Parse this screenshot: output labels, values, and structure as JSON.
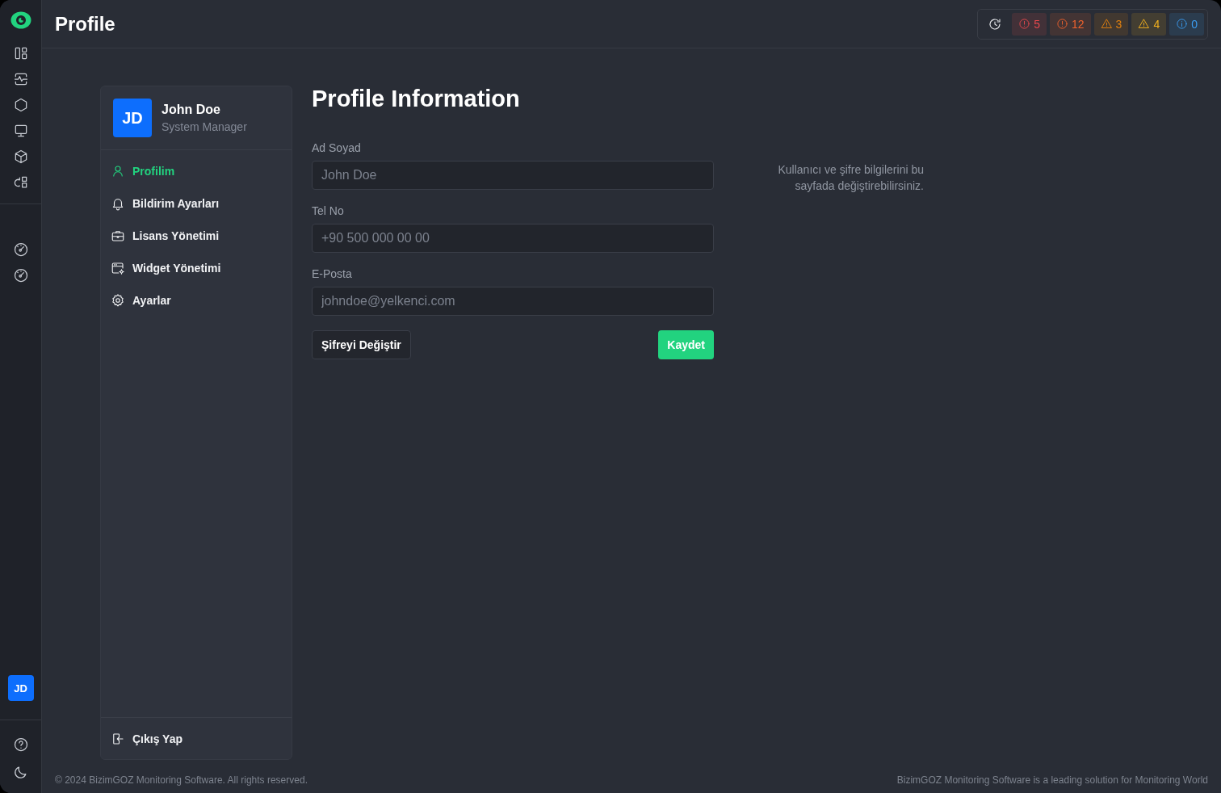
{
  "rail": {
    "top_icons": [
      {
        "kind": "layout"
      },
      {
        "kind": "pulse"
      },
      {
        "kind": "hexagon"
      },
      {
        "kind": "monitor"
      },
      {
        "kind": "cube"
      },
      {
        "kind": "refresh-grid"
      }
    ],
    "mid_icons": [
      {
        "kind": "gauge"
      },
      {
        "kind": "gauge"
      }
    ],
    "avatar": "JD",
    "bottom_icons": [
      {
        "kind": "help"
      },
      {
        "kind": "moon"
      }
    ]
  },
  "header": {
    "title": "Profile",
    "alerts": [
      {
        "kind": "error",
        "count": "5",
        "color": "#e5484d"
      },
      {
        "kind": "error",
        "count": "12",
        "color": "#f0622d"
      },
      {
        "kind": "warning",
        "count": "3",
        "color": "#e0800f"
      },
      {
        "kind": "warning",
        "count": "4",
        "color": "#f2b01e"
      },
      {
        "kind": "info",
        "count": "0",
        "color": "#3b9cf0"
      }
    ]
  },
  "profile_menu": {
    "avatar": "JD",
    "name": "John Doe",
    "role": "System Manager",
    "items": [
      {
        "kind": "user",
        "label": "Profilim",
        "selected": true
      },
      {
        "kind": "bell",
        "label": "Bildirim Ayarları",
        "selected": false
      },
      {
        "kind": "briefcase",
        "label": "Lisans Yönetimi",
        "selected": false
      },
      {
        "kind": "widget",
        "label": "Widget Yönetimi",
        "selected": false
      },
      {
        "kind": "gear",
        "label": "Ayarlar",
        "selected": false
      }
    ],
    "logout": "Çıkış Yap"
  },
  "form": {
    "title": "Profile Information",
    "fields": [
      {
        "label": "Ad Soyad",
        "placeholder": "John Doe"
      },
      {
        "label": "Tel No",
        "placeholder": "+90 500 000 00 00"
      },
      {
        "label": "E-Posta",
        "placeholder": "johndoe@yelkenci.com"
      }
    ],
    "secondary_button": "Şifreyi Değiştir",
    "primary_button": "Kaydet"
  },
  "hint": "Kullanıcı ve şifre bilgilerini bu sayfada değiştirebilirsiniz.",
  "footer": {
    "left": "© 2024 BizimGOZ Monitoring Software. All rights reserved.",
    "right": "BizimGOZ Monitoring Software is a leading solution for Monitoring World"
  }
}
